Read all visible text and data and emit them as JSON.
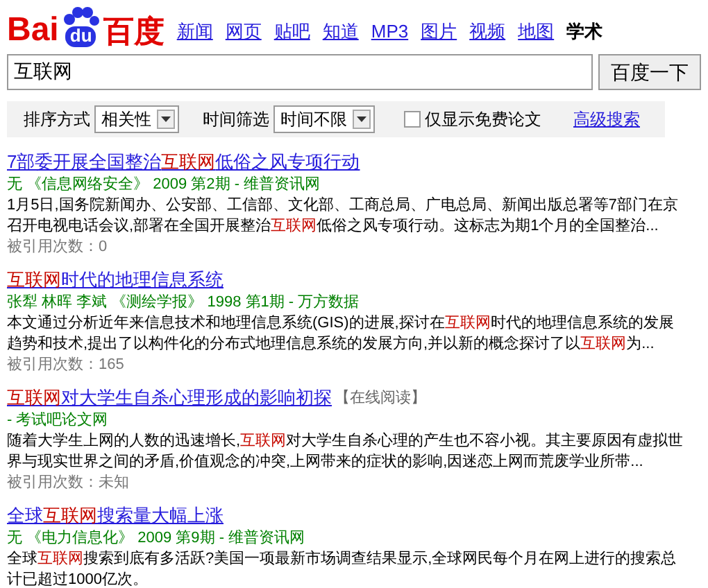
{
  "logo": {
    "left": "Bai",
    "paw": "du",
    "right": "百度"
  },
  "nav": [
    {
      "label": "新闻",
      "selected": false
    },
    {
      "label": "网页",
      "selected": false
    },
    {
      "label": "贴吧",
      "selected": false
    },
    {
      "label": "知道",
      "selected": false
    },
    {
      "label": "MP3",
      "selected": false
    },
    {
      "label": "图片",
      "selected": false
    },
    {
      "label": "视频",
      "selected": false
    },
    {
      "label": "地图",
      "selected": false
    },
    {
      "label": "学术",
      "selected": true
    }
  ],
  "search": {
    "value": "互联网",
    "button": "百度一下"
  },
  "filters": {
    "sort_label": "排序方式",
    "sort_value": "相关性",
    "time_label": "时间筛选",
    "time_value": "时间不限",
    "free_only": {
      "label": "仅显示免费论文",
      "checked": false
    },
    "advanced": "高级搜索"
  },
  "results": [
    {
      "title": [
        {
          "text": "7部委开展全国整治",
          "highlight": false
        },
        {
          "text": "互联网",
          "highlight": true
        },
        {
          "text": "低俗之风专项行动",
          "highlight": false
        }
      ],
      "source": "无 《信息网络安全》 2009 第2期 - 维普资讯网",
      "snippet": [
        {
          "text": "1月5日,国务院新闻办、公安部、工信部、文化部、工商总局、广电总局、新闻出版总署等7部门在京召开电视电话会议,部署在全国开展整治",
          "highlight": false
        },
        {
          "text": "互联网",
          "highlight": true
        },
        {
          "text": "低俗之风专项行动。这标志为期1个月的全国整治...",
          "highlight": false
        }
      ],
      "cited": "被引用次数：0"
    },
    {
      "title": [
        {
          "text": "互联网",
          "highlight": true
        },
        {
          "text": "时代的地理信息系统",
          "highlight": false
        }
      ],
      "source": "张犁 林晖 李斌 《测绘学报》 1998 第1期 - 万方数据",
      "snippet": [
        {
          "text": "本文通过分析近年来信息技术和地理信息系统(GIS)的进展,探讨在",
          "highlight": false
        },
        {
          "text": "互联网",
          "highlight": true
        },
        {
          "text": "时代的地理信息系统的发展趋势和技术,提出了以构件化的分布式地理信息系统的发展方向,并以新的概念探讨了以",
          "highlight": false
        },
        {
          "text": "互联网",
          "highlight": true
        },
        {
          "text": "为...",
          "highlight": false
        }
      ],
      "cited": "被引用次数：165"
    },
    {
      "title": [
        {
          "text": "互联网",
          "highlight": true
        },
        {
          "text": "对大学生自杀心理形成的影响初探",
          "highlight": false
        }
      ],
      "tag": "【在线阅读】",
      "source": "- 考试吧论文网",
      "snippet": [
        {
          "text": "随着大学生上网的人数的迅速增长,",
          "highlight": false
        },
        {
          "text": "互联网",
          "highlight": true
        },
        {
          "text": "对大学生自杀心理的产生也不容小视。其主要原因有虚拟世界与现实世界之间的矛盾,价值观念的冲突,上网带来的症状的影响,因迷恋上网而荒废学业所带...",
          "highlight": false
        }
      ],
      "cited": "被引用次数：未知"
    },
    {
      "title": [
        {
          "text": "全球",
          "highlight": false
        },
        {
          "text": "互联网",
          "highlight": true
        },
        {
          "text": "搜索量大幅上涨",
          "highlight": false
        }
      ],
      "source": "无 《电力信息化》 2009 第9期 - 维普资讯网",
      "snippet": [
        {
          "text": "全球",
          "highlight": false
        },
        {
          "text": "互联网",
          "highlight": true
        },
        {
          "text": "搜索到底有多活跃?美国一项最新市场调查结果显示,全球网民每个月在网上进行的搜索总计已超过1000亿次。",
          "highlight": false
        }
      ]
    }
  ]
}
